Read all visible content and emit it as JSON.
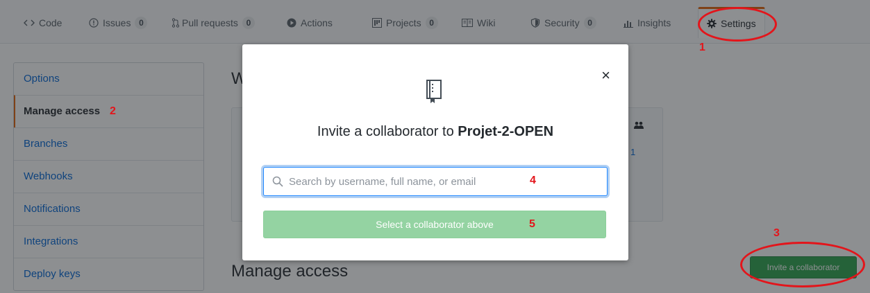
{
  "reponav": {
    "tabs": [
      {
        "label": "Code",
        "icon": "code-icon"
      },
      {
        "label": "Issues",
        "icon": "issue-icon",
        "count": "0"
      },
      {
        "label": "Pull requests",
        "icon": "pull-request-icon",
        "count": "0"
      },
      {
        "label": "Actions",
        "icon": "play-icon"
      },
      {
        "label": "Projects",
        "icon": "project-icon",
        "count": "0"
      },
      {
        "label": "Wiki",
        "icon": "book-icon"
      },
      {
        "label": "Security",
        "icon": "shield-icon",
        "count": "0"
      },
      {
        "label": "Insights",
        "icon": "graph-icon"
      },
      {
        "label": "Settings",
        "icon": "gear-icon"
      }
    ]
  },
  "sidebar": {
    "items": [
      {
        "label": "Options"
      },
      {
        "label": "Manage access"
      },
      {
        "label": "Branches"
      },
      {
        "label": "Webhooks"
      },
      {
        "label": "Notifications"
      },
      {
        "label": "Integrations"
      },
      {
        "label": "Deploy keys"
      }
    ]
  },
  "main": {
    "partial_heading": "W",
    "section_title": "Manage access",
    "invite_button": "Invite a collaborator",
    "team_count": "1"
  },
  "modal": {
    "title_prefix": "Invite a collaborator to ",
    "repo_name": "Projet-2-OPEN",
    "close_glyph": "×",
    "search_placeholder": "Search by username, full name, or email",
    "search_value": "",
    "submit_label": "Select a collaborator above"
  },
  "annotations": {
    "n1": "1",
    "n2": "2",
    "n3": "3",
    "n4": "4",
    "n5": "5"
  },
  "colors": {
    "accent_orange": "#e36209",
    "link_blue": "#0366d6",
    "annotation_red": "#e3151b",
    "primary_green": "#2ea44f",
    "disabled_green": "#94d3a2"
  }
}
